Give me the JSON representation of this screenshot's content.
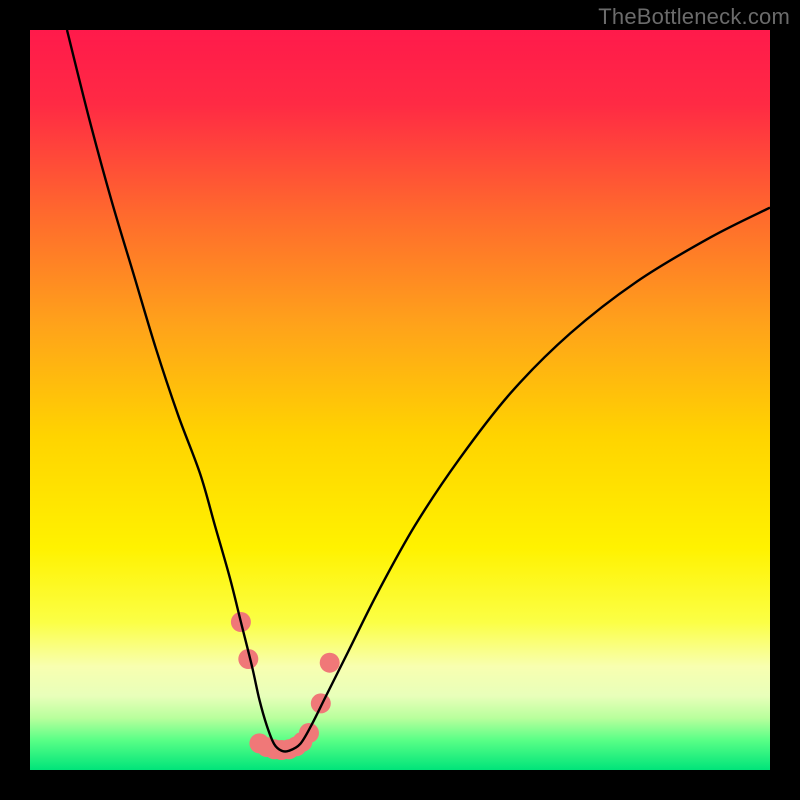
{
  "watermark": "TheBottleneck.com",
  "chart_data": {
    "type": "line",
    "title": "",
    "xlabel": "",
    "ylabel": "",
    "xlim": [
      0,
      100
    ],
    "ylim": [
      0,
      100
    ],
    "background_gradient": {
      "stops": [
        {
          "offset": 0.0,
          "color": "#ff1a4b"
        },
        {
          "offset": 0.1,
          "color": "#ff2a44"
        },
        {
          "offset": 0.25,
          "color": "#ff6a2d"
        },
        {
          "offset": 0.4,
          "color": "#ffa31a"
        },
        {
          "offset": 0.55,
          "color": "#ffd400"
        },
        {
          "offset": 0.7,
          "color": "#fff200"
        },
        {
          "offset": 0.8,
          "color": "#fbff45"
        },
        {
          "offset": 0.86,
          "color": "#f8ffb0"
        },
        {
          "offset": 0.9,
          "color": "#e8ffba"
        },
        {
          "offset": 0.93,
          "color": "#b8ff9c"
        },
        {
          "offset": 0.96,
          "color": "#58ff86"
        },
        {
          "offset": 1.0,
          "color": "#00e47a"
        }
      ]
    },
    "series": [
      {
        "name": "bottleneck-curve",
        "color": "#000000",
        "x": [
          5,
          8,
          11,
          14,
          17,
          20,
          23,
          25,
          27,
          28.5,
          30,
          31,
          32,
          33,
          34,
          35,
          36.5,
          38,
          40,
          43,
          47,
          52,
          58,
          65,
          73,
          82,
          92,
          100
        ],
        "y": [
          100,
          88,
          77,
          67,
          57,
          48,
          40,
          33,
          26,
          20,
          14,
          9.5,
          6,
          3.5,
          2.6,
          2.6,
          3.5,
          6,
          10,
          16,
          24,
          33,
          42,
          51,
          59,
          66,
          72,
          76
        ]
      }
    ],
    "markers": {
      "name": "highlighted-points",
      "color": "#f07878",
      "radius_percent": 1.35,
      "points": [
        {
          "x": 28.5,
          "y": 20
        },
        {
          "x": 29.5,
          "y": 15
        },
        {
          "x": 31,
          "y": 3.6
        },
        {
          "x": 32,
          "y": 3.1
        },
        {
          "x": 33,
          "y": 2.8
        },
        {
          "x": 34,
          "y": 2.7
        },
        {
          "x": 35,
          "y": 2.8
        },
        {
          "x": 36,
          "y": 3.2
        },
        {
          "x": 36.8,
          "y": 3.8
        },
        {
          "x": 37.7,
          "y": 5.0
        },
        {
          "x": 39.3,
          "y": 9.0
        },
        {
          "x": 40.5,
          "y": 14.5
        }
      ]
    }
  }
}
